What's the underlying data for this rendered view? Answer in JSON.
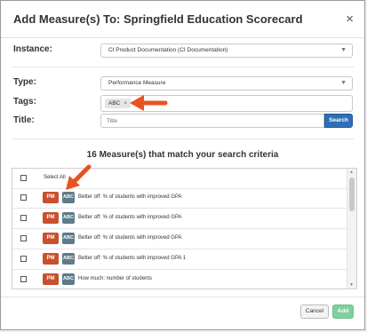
{
  "dialog": {
    "title": "Add Measure(s) To: Springfield Education Scorecard",
    "close_glyph": "×"
  },
  "form": {
    "instance_label": "Instance:",
    "instance_value": "CI Product Documentation (CI Documentation)",
    "type_label": "Type:",
    "type_value": "Performance Measure",
    "tags_label": "Tags:",
    "tag_chip": "ABC",
    "tag_remove_glyph": "×",
    "title_label": "Title:",
    "title_placeholder": "Title",
    "search_label": "Search"
  },
  "results": {
    "heading": "16 Measure(s) that match your search criteria",
    "select_all": "Select All",
    "badge_pm": "PM",
    "badge_abc": "ABC",
    "rows": [
      "Better off: % of students with improved GPA",
      "Better off: % of students with improved GPA",
      "Better off: % of students with improved GPA",
      "Better off: % of students with improved GPA 1",
      "How much: number of students"
    ]
  },
  "footer": {
    "cancel": "Cancel",
    "add": "Add"
  },
  "colors": {
    "accent": "#2f6fb6",
    "pm_badge": "#c8502c",
    "abc_badge": "#5f7a8a",
    "add_button": "#7fd09d",
    "annotation_arrow": "#e8531f"
  },
  "icons": {
    "close": "close-icon",
    "dropdown": "chevron-down-icon",
    "annotation": "arrow-pointer-icon"
  }
}
